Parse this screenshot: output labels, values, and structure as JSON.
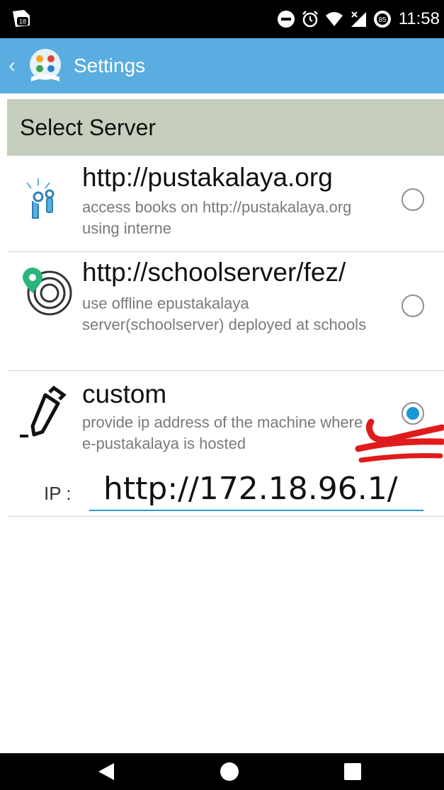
{
  "status_bar": {
    "notification_badge": "18",
    "battery_level": "85",
    "time": "11:58"
  },
  "app_bar": {
    "back_glyph": "‹",
    "title": "Settings"
  },
  "section": {
    "title": "Select Server"
  },
  "options": [
    {
      "title": "http://pustakalaya.org",
      "description": "access books on http://pustakalaya.org using interne",
      "icon": "antenna-icon",
      "selected": false
    },
    {
      "title": "http://schoolserver/fez/",
      "description": "use offline epustakalaya server(schoolserver) deployed at schools",
      "icon": "location-pin-icon",
      "selected": false
    },
    {
      "title": "custom",
      "description": "provide ip address of the machine where e-pustakalaya is hosted",
      "icon": "pencil-icon",
      "selected": true
    }
  ],
  "ip": {
    "label": "IP :",
    "value": "http://172.18.96.1/"
  },
  "colors": {
    "status_bar": "#000000",
    "app_bar": "#5aade0",
    "section_header": "#c6cfbd",
    "radio_selected": "#1a95d6",
    "annotation": "#e01b1b"
  },
  "nav_bar": {
    "back": "back-triangle-icon",
    "home": "home-circle-icon",
    "recents": "recents-square-icon"
  }
}
